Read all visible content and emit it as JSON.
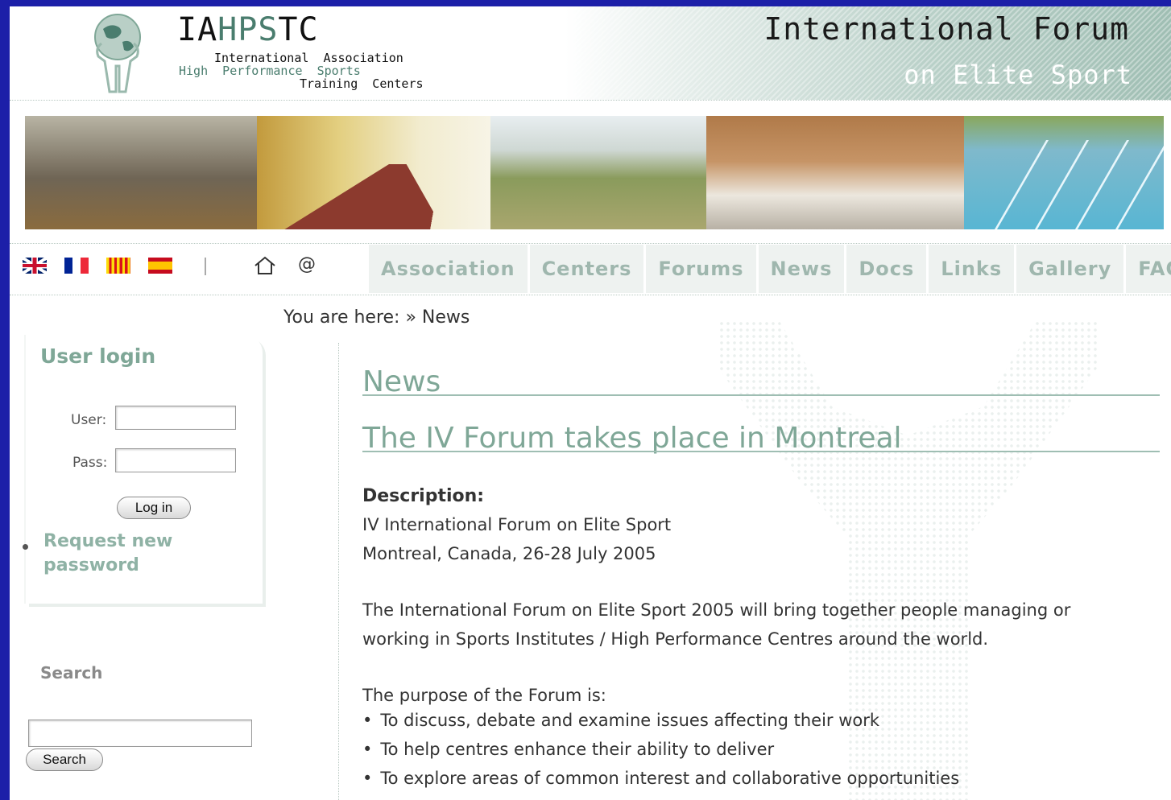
{
  "header": {
    "logo_acronym_start": "IA",
    "logo_acronym_mid": "HPS",
    "logo_acronym_end": "TC",
    "logo_line1": "International  Association",
    "logo_line2": "High  Performance  Sports",
    "logo_line3": "Training  Centers",
    "forum_title": "International Forum",
    "forum_subtitle": "on Elite Sport"
  },
  "language_icons": [
    "uk-flag-icon",
    "france-flag-icon",
    "catalonia-flag-icon",
    "spain-flag-icon",
    "home-icon",
    "at-icon"
  ],
  "nav": {
    "items": [
      "Association",
      "Centers",
      "Forums",
      "News",
      "Docs",
      "Links",
      "Gallery",
      "FAQ"
    ]
  },
  "breadcrumb": "You are here: » News",
  "sidebar": {
    "login_title": "User login",
    "user_label": "User:",
    "user_value": "",
    "pass_label": "Pass:",
    "pass_value": "",
    "login_button": "Log in",
    "request_password_link": "Request new password",
    "search_title": "Search",
    "search_value": "",
    "search_button": "Search"
  },
  "main": {
    "page_title": "News",
    "article_title": "The IV Forum takes place in Montreal",
    "description_label": "Description:",
    "description_line1": "IV International Forum on Elite Sport",
    "description_line2": "Montreal, Canada, 26-28 July 2005",
    "paragraph_line1": "The International Forum on Elite Sport 2005 will bring together people managing or",
    "paragraph_line2": "working in Sports Institutes / High Performance Centres around the world.",
    "purpose_intro": "The purpose of the Forum is:",
    "purpose_items": [
      "To discuss, debate and examine issues affecting their work",
      "To help centres enhance their ability to deliver",
      "To explore areas of common interest and collaborative opportunities"
    ]
  },
  "colors": {
    "accent": "#7fa797",
    "slide_background": "#1c1fa8",
    "nav_tab": "#eef2f0"
  }
}
